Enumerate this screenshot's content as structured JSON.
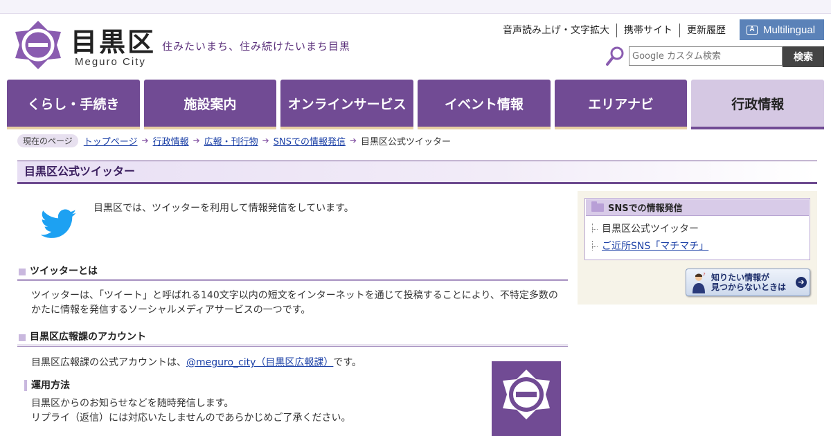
{
  "header": {
    "logo_text": "目黒区",
    "logo_sub": "Meguro City",
    "tagline": "住みたいまち、住み続けたいまち目黒",
    "util_links": [
      "音声読み上げ・文字拡大",
      "携帯サイト",
      "更新履歴"
    ],
    "multilingual": "Multilingual",
    "search_placeholder": "Google カスタム検索",
    "search_button": "検索"
  },
  "nav": [
    {
      "label": "くらし・手続き"
    },
    {
      "label": "施設案内"
    },
    {
      "label": "オンラインサービス"
    },
    {
      "label": "イベント情報"
    },
    {
      "label": "エリアナビ"
    },
    {
      "label": "行政情報"
    }
  ],
  "breadcrumb": {
    "here": "現在のページ",
    "items": [
      "トップページ",
      "行政情報",
      "広報・刊行物",
      "SNSでの情報発信"
    ],
    "current": "目黒区公式ツイッター"
  },
  "page": {
    "title": "目黒区公式ツイッター",
    "intro": "目黒区では、ツイッターを利用して情報発信をしています。",
    "sec1_title": "ツイッターとは",
    "sec1_line1": "ツイッターは、「ツイート」と呼ばれる140文字以内の短文をインターネットを通じて投稿することにより、不特定多数の",
    "sec1_line2": "かたに情報を発信するソーシャルメディアサービスの一つです。",
    "sec2_title": "目黒区広報課のアカウント",
    "sec2_pre": "目黒区広報課の公式アカウントは、",
    "sec2_link": "@meguro_city（目黒区広報課）",
    "sec2_post": "です。",
    "sub_title": "運用方法",
    "sub_line1": "目黒区からのお知らせなどを随時発信します。",
    "sub_line2": "リプライ（返信）には対応いたしませんのであらかじめご了承ください。"
  },
  "sidebar": {
    "title": "SNSでの情報発信",
    "items": [
      "目黒区公式ツイッター",
      "ご近所SNS「マチマチ」"
    ],
    "help_line1": "知りたい情報が",
    "help_line2": "見つからないときは"
  },
  "colors": {
    "brand_purple": "#714b94",
    "nav_active": "#d5c8e3",
    "multilingual_blue": "#5b82b8",
    "twitter_blue": "#1da1f2"
  }
}
